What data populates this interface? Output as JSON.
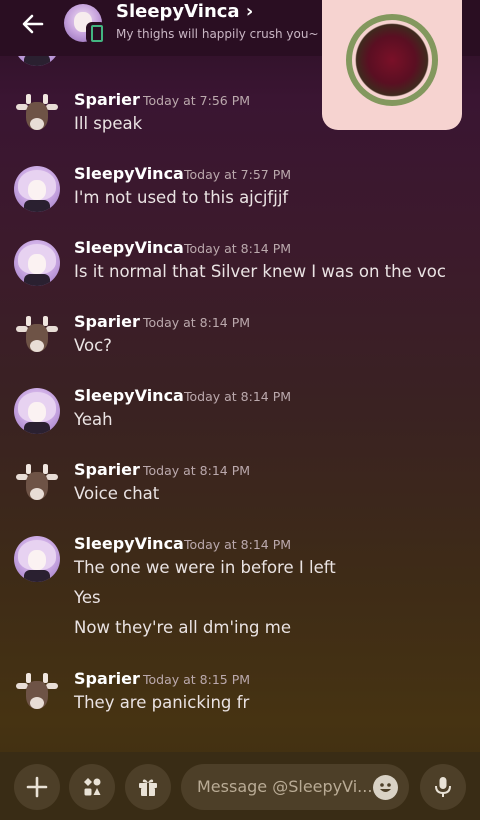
{
  "header": {
    "title": "SleepyVinca",
    "chevron": "›",
    "status": "My thighs will happily crush you~"
  },
  "messages": [
    {
      "user": "Sparier",
      "time": "Today at 7:56 PM",
      "lines": [
        "Ill speak"
      ]
    },
    {
      "user": "SleepyVinca",
      "time": "Today at 7:57 PM",
      "lines": [
        "I'm not used to this ajcjfjjf"
      ]
    },
    {
      "user": "SleepyVinca",
      "time": "Today at 8:14 PM",
      "lines": [
        "Is it normal that Silver knew I was on the voc"
      ]
    },
    {
      "user": "Sparier",
      "time": "Today at 8:14 PM",
      "lines": [
        "Voc?"
      ]
    },
    {
      "user": "SleepyVinca",
      "time": "Today at 8:14 PM",
      "lines": [
        "Yeah"
      ]
    },
    {
      "user": "Sparier",
      "time": "Today at 8:14 PM",
      "lines": [
        "Voice chat"
      ]
    },
    {
      "user": "SleepyVinca",
      "time": "Today at 8:14 PM",
      "lines": [
        "The one we were in before I left",
        "Yes",
        "Now they're all dm'ing me"
      ]
    },
    {
      "user": "Sparier",
      "time": "Today at 8:15 PM",
      "lines": [
        "They are panicking fr"
      ]
    }
  ],
  "composer": {
    "placeholder": "Message @SleepyVi..."
  },
  "icons": {
    "back": "arrow-left-icon",
    "add": "plus-icon",
    "apps": "apps-icon",
    "gift": "gift-icon",
    "emoji": "emoji-icon",
    "mic": "microphone-icon",
    "mobile": "mobile-status-icon"
  },
  "colors": {
    "online": "#43b581",
    "background_top": "#2b0f24",
    "background_bottom": "#463312"
  }
}
